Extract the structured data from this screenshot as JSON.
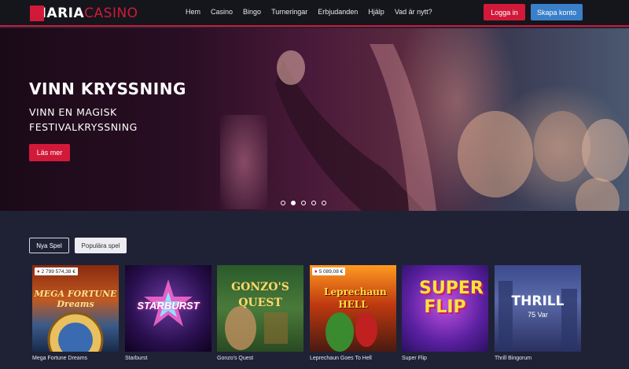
{
  "header": {
    "logo_maria": "MARIA",
    "logo_casino": "CASINO",
    "nav": [
      "Hem",
      "Casino",
      "Bingo",
      "Turneringar",
      "Erbjudanden",
      "Hjälp",
      "Vad är nytt?"
    ],
    "login_label": "Logga in",
    "signup_label": "Skapa konto",
    "accent_color": "#d2193a",
    "signup_color": "#3a7fc9"
  },
  "hero": {
    "title": "VINN KRYSSNING",
    "subtitle": "VINN EN MAGISK FESTIVALKRYSSNING",
    "cta_label": "Läs mer",
    "slide_count": 5,
    "active_slide": 2
  },
  "tabs": {
    "new_label": "Nya Spel",
    "popular_label": "Populära spel"
  },
  "games": [
    {
      "name": "Mega Fortune Dreams",
      "jackpot": "2 799 574,38 €",
      "art_text": "MEGA FORTUNE Dreams"
    },
    {
      "name": "Starburst",
      "jackpot": "",
      "art_text": "STARBURST"
    },
    {
      "name": "Gonzo's Quest",
      "jackpot": "",
      "art_text": "GONZO'S QUEST"
    },
    {
      "name": "Leprechaun Goes To Hell",
      "jackpot": "5 089,08 €",
      "art_text": "Leprechaun HELL"
    },
    {
      "name": "Super Flip",
      "jackpot": "",
      "art_text": "SUPER FLIP"
    },
    {
      "name": "Thrill Bingorum",
      "jackpot": "",
      "art_text": "THRILL",
      "art_sub": "75 Var"
    }
  ]
}
